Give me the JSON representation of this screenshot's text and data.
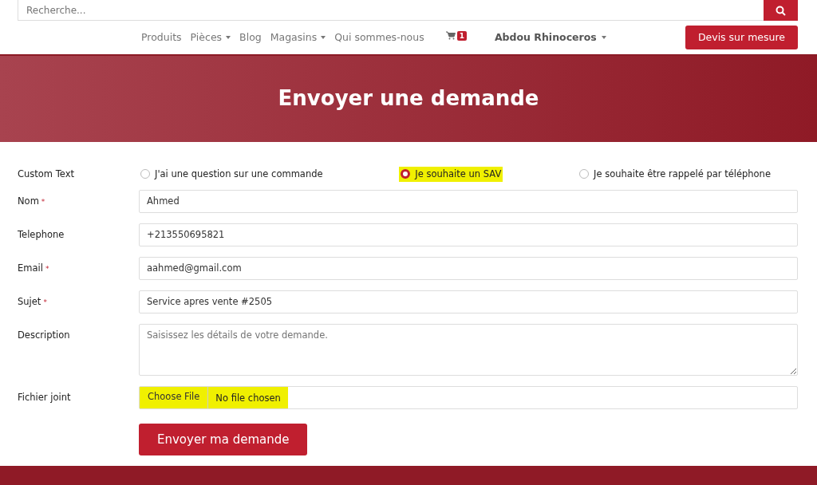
{
  "search": {
    "placeholder": "Recherche..."
  },
  "nav": {
    "items": [
      {
        "label": "Produits",
        "dropdown": false
      },
      {
        "label": "Pièces",
        "dropdown": true
      },
      {
        "label": "Blog",
        "dropdown": false
      },
      {
        "label": "Magasins",
        "dropdown": true
      },
      {
        "label": "Qui sommes-nous",
        "dropdown": false
      }
    ],
    "cart_count": "1",
    "user": "Abdou Rhinoceros",
    "quote_button": "Devis sur mesure"
  },
  "hero": {
    "title": "Envoyer une demande"
  },
  "form": {
    "choice": {
      "label": "Custom Text",
      "options": [
        {
          "label": "J'ai une question sur une commande",
          "selected": false,
          "highlighted": false
        },
        {
          "label": "Je souhaite un SAV",
          "selected": true,
          "highlighted": true
        },
        {
          "label": "Je souhaite être rappelé par téléphone",
          "selected": false,
          "highlighted": false
        }
      ]
    },
    "fields": [
      {
        "kind": "input",
        "label": "Nom",
        "required_mark": "*",
        "value": "Ahmed"
      },
      {
        "kind": "input",
        "label": "Telephone",
        "value": "+213550695821"
      },
      {
        "kind": "input",
        "label": "Email",
        "required_mark": "*",
        "value": "aahmed@gmail.com"
      },
      {
        "kind": "input",
        "label": "Sujet",
        "required_mark": "*",
        "value": "Service apres vente #2505"
      },
      {
        "kind": "textarea",
        "label": "Description",
        "placeholder": "Saisissez les détails de votre demande."
      },
      {
        "kind": "file",
        "label": "Fichier joint",
        "button": "Choose File",
        "status": "No file chosen",
        "highlighted": true
      }
    ],
    "submit": "Envoyer ma demande"
  }
}
